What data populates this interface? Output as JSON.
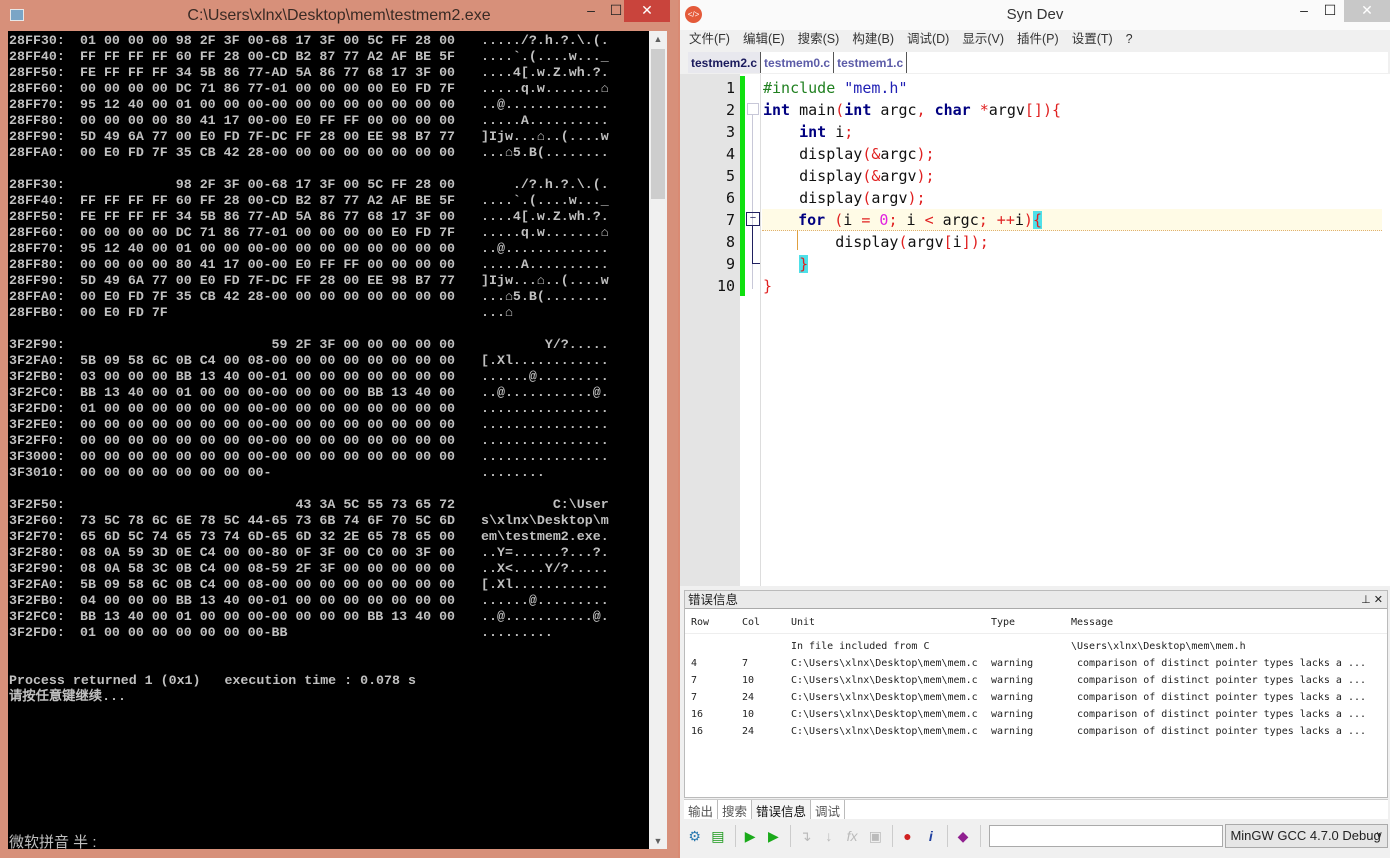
{
  "console": {
    "title": "C:\\Users\\xlnx\\Desktop\\mem\\testmem2.exe",
    "lines": [
      {
        "addr": "28FF30:",
        "hex": "01 00 00 00 98 2F 3F 00-68 17 3F 00 5C FF 28 00",
        "ascii": "...../?.h.?.\\.(."
      },
      {
        "addr": "28FF40:",
        "hex": "FF FF FF FF 60 FF 28 00-CD B2 87 77 A2 AF BE 5F",
        "ascii": "....`.(....w..._"
      },
      {
        "addr": "28FF50:",
        "hex": "FE FF FF FF 34 5B 86 77-AD 5A 86 77 68 17 3F 00",
        "ascii": "....4[.w.Z.wh.?."
      },
      {
        "addr": "28FF60:",
        "hex": "00 00 00 00 DC 71 86 77-01 00 00 00 00 E0 FD 7F",
        "ascii": ".....q.w.......⌂"
      },
      {
        "addr": "28FF70:",
        "hex": "95 12 40 00 01 00 00 00-00 00 00 00 00 00 00 00",
        "ascii": "..@............."
      },
      {
        "addr": "28FF80:",
        "hex": "00 00 00 00 80 41 17 00-00 E0 FF FF 00 00 00 00",
        "ascii": ".....A.........."
      },
      {
        "addr": "28FF90:",
        "hex": "5D 49 6A 77 00 E0 FD 7F-DC FF 28 00 EE 98 B7 77",
        "ascii": "]Ijw...⌂..(....w"
      },
      {
        "addr": "28FFA0:",
        "hex": "00 E0 FD 7F 35 CB 42 28-00 00 00 00 00 00 00 00",
        "ascii": "...⌂5.B(........"
      },
      {
        "addr": "",
        "hex": "",
        "ascii": ""
      },
      {
        "addr": "28FF30:",
        "hex": "            98 2F 3F 00-68 17 3F 00 5C FF 28 00",
        "ascii": "    ./?.h.?.\\.(."
      },
      {
        "addr": "28FF40:",
        "hex": "FF FF FF FF 60 FF 28 00-CD B2 87 77 A2 AF BE 5F",
        "ascii": "....`.(....w..._"
      },
      {
        "addr": "28FF50:",
        "hex": "FE FF FF FF 34 5B 86 77-AD 5A 86 77 68 17 3F 00",
        "ascii": "....4[.w.Z.wh.?."
      },
      {
        "addr": "28FF60:",
        "hex": "00 00 00 00 DC 71 86 77-01 00 00 00 00 E0 FD 7F",
        "ascii": ".....q.w.......⌂"
      },
      {
        "addr": "28FF70:",
        "hex": "95 12 40 00 01 00 00 00-00 00 00 00 00 00 00 00",
        "ascii": "..@............."
      },
      {
        "addr": "28FF80:",
        "hex": "00 00 00 00 80 41 17 00-00 E0 FF FF 00 00 00 00",
        "ascii": ".....A.........."
      },
      {
        "addr": "28FF90:",
        "hex": "5D 49 6A 77 00 E0 FD 7F-DC FF 28 00 EE 98 B7 77",
        "ascii": "]Ijw...⌂..(....w"
      },
      {
        "addr": "28FFA0:",
        "hex": "00 E0 FD 7F 35 CB 42 28-00 00 00 00 00 00 00 00",
        "ascii": "...⌂5.B(........"
      },
      {
        "addr": "28FFB0:",
        "hex": "00 E0 FD 7F",
        "ascii": "...⌂"
      },
      {
        "addr": "",
        "hex": "",
        "ascii": ""
      },
      {
        "addr": "3F2F90:",
        "hex": "                        59 2F 3F 00 00 00 00 00",
        "ascii": "        Y/?....."
      },
      {
        "addr": "3F2FA0:",
        "hex": "5B 09 58 6C 0B C4 00 08-00 00 00 00 00 00 00 00",
        "ascii": "[.Xl............"
      },
      {
        "addr": "3F2FB0:",
        "hex": "03 00 00 00 BB 13 40 00-01 00 00 00 00 00 00 00",
        "ascii": "......@........."
      },
      {
        "addr": "3F2FC0:",
        "hex": "BB 13 40 00 01 00 00 00-00 00 00 00 BB 13 40 00",
        "ascii": "..@...........@."
      },
      {
        "addr": "3F2FD0:",
        "hex": "01 00 00 00 00 00 00 00-00 00 00 00 00 00 00 00",
        "ascii": "................"
      },
      {
        "addr": "3F2FE0:",
        "hex": "00 00 00 00 00 00 00 00-00 00 00 00 00 00 00 00",
        "ascii": "................"
      },
      {
        "addr": "3F2FF0:",
        "hex": "00 00 00 00 00 00 00 00-00 00 00 00 00 00 00 00",
        "ascii": "................"
      },
      {
        "addr": "3F3000:",
        "hex": "00 00 00 00 00 00 00 00-00 00 00 00 00 00 00 00",
        "ascii": "................"
      },
      {
        "addr": "3F3010:",
        "hex": "00 00 00 00 00 00 00 00-",
        "ascii": "........"
      },
      {
        "addr": "",
        "hex": "",
        "ascii": ""
      },
      {
        "addr": "3F2F50:",
        "hex": "                           43 3A 5C 55 73 65 72",
        "ascii": "         C:\\User"
      },
      {
        "addr": "3F2F60:",
        "hex": "73 5C 78 6C 6E 78 5C 44-65 73 6B 74 6F 70 5C 6D",
        "ascii": "s\\xlnx\\Desktop\\m"
      },
      {
        "addr": "3F2F70:",
        "hex": "65 6D 5C 74 65 73 74 6D-65 6D 32 2E 65 78 65 00",
        "ascii": "em\\testmem2.exe."
      },
      {
        "addr": "3F2F80:",
        "hex": "08 0A 59 3D 0E C4 00 00-80 0F 3F 00 C0 00 3F 00",
        "ascii": "..Y=......?...?."
      },
      {
        "addr": "3F2F90:",
        "hex": "08 0A 58 3C 0B C4 00 08-59 2F 3F 00 00 00 00 00",
        "ascii": "..X<....Y/?....."
      },
      {
        "addr": "3F2FA0:",
        "hex": "5B 09 58 6C 0B C4 00 08-00 00 00 00 00 00 00 00",
        "ascii": "[.Xl............"
      },
      {
        "addr": "3F2FB0:",
        "hex": "04 00 00 00 BB 13 40 00-01 00 00 00 00 00 00 00",
        "ascii": "......@........."
      },
      {
        "addr": "3F2FC0:",
        "hex": "BB 13 40 00 01 00 00 00-00 00 00 00 BB 13 40 00",
        "ascii": "..@...........@."
      },
      {
        "addr": "3F2FD0:",
        "hex": "01 00 00 00 00 00 00 00-BB",
        "ascii": "........."
      },
      {
        "addr": "",
        "hex": "",
        "ascii": ""
      },
      {
        "addr": "",
        "hex": "",
        "ascii": ""
      }
    ],
    "process_returned": "Process returned 1 (0x1)   execution time : 0.078 s",
    "press_any_key": "请按任意键继续...",
    "ime_status": "微软拼音 半 :"
  },
  "ide": {
    "title": "Syn Dev",
    "menu": [
      "文件(F)",
      "编辑(E)",
      "搜索(S)",
      "构建(B)",
      "调试(D)",
      "显示(V)",
      "插件(P)",
      "设置(T)",
      "?"
    ],
    "tabs": [
      {
        "label": "testmem2.c",
        "active": true
      },
      {
        "label": "testmem0.c",
        "active": false
      },
      {
        "label": "testmem1.c",
        "active": false
      }
    ],
    "code": [
      [
        {
          "t": "pp",
          "s": "#include "
        },
        {
          "t": "str",
          "s": "\"mem.h\""
        }
      ],
      [
        {
          "t": "kw",
          "s": "int"
        },
        {
          "t": "id",
          "s": " main"
        },
        {
          "t": "p",
          "s": "("
        },
        {
          "t": "kw",
          "s": "int"
        },
        {
          "t": "id",
          "s": " argc"
        },
        {
          "t": "p",
          "s": ", "
        },
        {
          "t": "kw",
          "s": "char"
        },
        {
          "t": "p",
          "s": " *"
        },
        {
          "t": "id",
          "s": "argv"
        },
        {
          "t": "p",
          "s": "[]){"
        }
      ],
      [
        {
          "t": "id",
          "s": "    "
        },
        {
          "t": "kw",
          "s": "int"
        },
        {
          "t": "id",
          "s": " i"
        },
        {
          "t": "p",
          "s": ";"
        }
      ],
      [
        {
          "t": "id",
          "s": "    display"
        },
        {
          "t": "p",
          "s": "(&"
        },
        {
          "t": "id",
          "s": "argc"
        },
        {
          "t": "p",
          "s": ");"
        }
      ],
      [
        {
          "t": "id",
          "s": "    display"
        },
        {
          "t": "p",
          "s": "(&"
        },
        {
          "t": "id",
          "s": "argv"
        },
        {
          "t": "p",
          "s": ");"
        }
      ],
      [
        {
          "t": "id",
          "s": "    display"
        },
        {
          "t": "p",
          "s": "("
        },
        {
          "t": "id",
          "s": "argv"
        },
        {
          "t": "p",
          "s": ");"
        }
      ],
      [
        {
          "t": "id",
          "s": "    "
        },
        {
          "t": "kw",
          "s": "for"
        },
        {
          "t": "p",
          "s": " ("
        },
        {
          "t": "id",
          "s": "i "
        },
        {
          "t": "p",
          "s": "= "
        },
        {
          "t": "num",
          "s": "0"
        },
        {
          "t": "p",
          "s": "; "
        },
        {
          "t": "id",
          "s": "i "
        },
        {
          "t": "p",
          "s": "< "
        },
        {
          "t": "id",
          "s": "argc"
        },
        {
          "t": "p",
          "s": "; ++"
        },
        {
          "t": "id",
          "s": "i"
        },
        {
          "t": "p",
          "s": ")"
        },
        {
          "t": "br",
          "s": "{"
        }
      ],
      [
        {
          "t": "id",
          "s": "        display"
        },
        {
          "t": "p",
          "s": "("
        },
        {
          "t": "id",
          "s": "argv"
        },
        {
          "t": "p",
          "s": "["
        },
        {
          "t": "id",
          "s": "i"
        },
        {
          "t": "p",
          "s": "]);"
        }
      ],
      [
        {
          "t": "id",
          "s": "    "
        },
        {
          "t": "br",
          "s": "}"
        }
      ],
      [
        {
          "t": "p",
          "s": "}"
        }
      ]
    ],
    "current_line": 7,
    "error_panel": {
      "title": "错误信息",
      "columns": [
        "Row",
        "Col",
        "Unit",
        "Type",
        "Message"
      ],
      "rows": [
        [
          "",
          "",
          "In file included from C",
          "",
          "\\Users\\xlnx\\Desktop\\mem\\mem.h"
        ],
        [
          "4",
          "7",
          "C:\\Users\\xlnx\\Desktop\\mem\\mem.c",
          "warning",
          " comparison of distinct pointer types lacks a ..."
        ],
        [
          "7",
          "10",
          "C:\\Users\\xlnx\\Desktop\\mem\\mem.c",
          "warning",
          " comparison of distinct pointer types lacks a ..."
        ],
        [
          "7",
          "24",
          "C:\\Users\\xlnx\\Desktop\\mem\\mem.c",
          "warning",
          " comparison of distinct pointer types lacks a ..."
        ],
        [
          "16",
          "10",
          "C:\\Users\\xlnx\\Desktop\\mem\\mem.c",
          "warning",
          " comparison of distinct pointer types lacks a ..."
        ],
        [
          "16",
          "24",
          "C:\\Users\\xlnx\\Desktop\\mem\\mem.c",
          "warning",
          " comparison of distinct pointer types lacks a ..."
        ]
      ]
    },
    "bottom_tabs": [
      {
        "label": "输出",
        "active": false
      },
      {
        "label": "搜索",
        "active": false
      },
      {
        "label": "错误信息",
        "active": true
      },
      {
        "label": "调试",
        "active": false
      }
    ],
    "toolbar": {
      "icons": [
        "compile-icon",
        "build-run-icon",
        "run-icon",
        "run-debug-icon",
        "step-into-icon",
        "step-over-icon",
        "evaluate-icon",
        "watch-icon",
        "breakpoint-icon",
        "info-icon",
        "help-book-icon"
      ],
      "input_value": "",
      "compiler": "MinGW GCC 4.7.0 Debug"
    }
  },
  "colors": {
    "console_border": "#d7907a",
    "gutter_modified": "#10e010",
    "keyword": "#000080",
    "paren": "#e02020",
    "brace_match": "#4ee0e8"
  }
}
